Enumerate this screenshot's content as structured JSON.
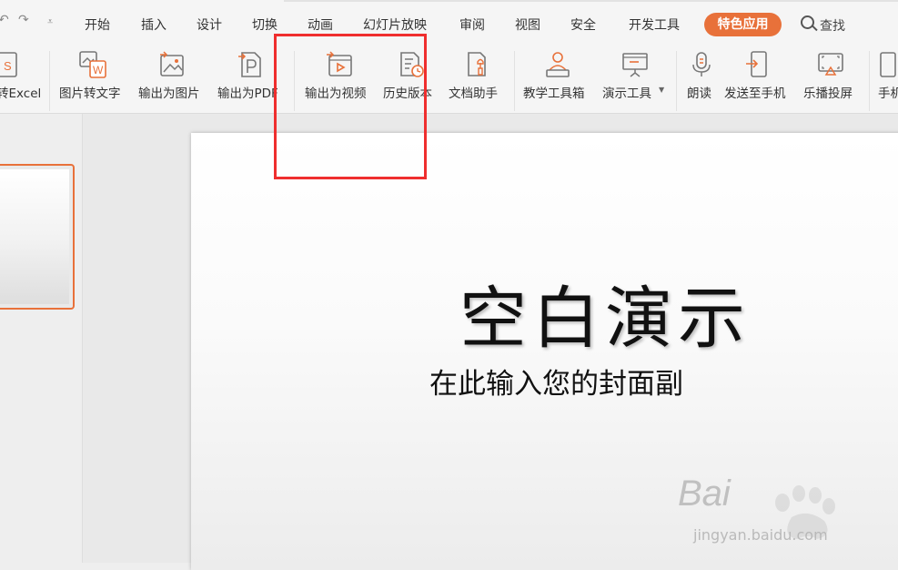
{
  "quick_access": {
    "undo_icon": "undo-icon",
    "redo_icon": "redo-icon",
    "customize_icon": "chevron-down-icon"
  },
  "menu": {
    "tabs": [
      "开始",
      "插入",
      "设计",
      "切换",
      "动画",
      "幻灯片放映",
      "审阅",
      "视图",
      "安全",
      "开发工具"
    ],
    "active_tab": "特色应用",
    "search_label": "查找"
  },
  "ribbon": {
    "buttons": [
      {
        "label": "转Excel",
        "icon": "excel-convert-icon"
      },
      {
        "label": "图片转文字",
        "icon": "image-to-text-icon"
      },
      {
        "label": "输出为图片",
        "icon": "export-image-icon"
      },
      {
        "label": "输出为PDF",
        "icon": "export-pdf-icon"
      },
      {
        "label": "输出为视频",
        "icon": "export-video-icon"
      },
      {
        "label": "历史版本",
        "icon": "history-version-icon"
      },
      {
        "label": "文档助手",
        "icon": "document-assistant-icon"
      },
      {
        "label": "教学工具箱",
        "icon": "teaching-toolbox-icon"
      },
      {
        "label": "演示工具",
        "icon": "presentation-tools-icon"
      },
      {
        "label": "朗读",
        "icon": "read-aloud-icon"
      },
      {
        "label": "发送至手机",
        "icon": "send-to-phone-icon"
      },
      {
        "label": "乐播投屏",
        "icon": "screen-cast-icon"
      },
      {
        "label": "手机",
        "icon": "phone-icon"
      }
    ]
  },
  "slide": {
    "title": "空白演示",
    "subtitle": "在此输入您的封面副"
  },
  "watermark": {
    "brand": "Bai",
    "url": "jingyan.baidu.com"
  },
  "colors": {
    "accent": "#e8713a",
    "highlight": "#ef2e2e"
  }
}
